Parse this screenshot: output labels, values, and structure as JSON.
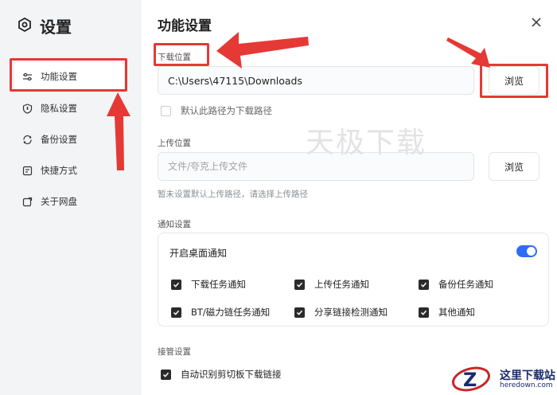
{
  "app": {
    "title": "设置"
  },
  "sidebar": {
    "items": [
      {
        "label": "功能设置",
        "icon": "sliders-icon",
        "active": true
      },
      {
        "label": "隐私设置",
        "icon": "shield-icon",
        "active": false
      },
      {
        "label": "备份设置",
        "icon": "sync-icon",
        "active": false
      },
      {
        "label": "快捷方式",
        "icon": "shortcut-icon",
        "active": false
      },
      {
        "label": "关于网盘",
        "icon": "info-icon",
        "active": false
      }
    ]
  },
  "main": {
    "title": "功能设置",
    "close_icon": "close-icon",
    "download": {
      "label": "下载位置",
      "path": "C:\\Users\\47115\\Downloads",
      "browse_label": "浏览",
      "default_checkbox_label": "默认此路径为下载路径",
      "default_checked": false
    },
    "upload": {
      "label": "上传位置",
      "placeholder": "文件/夸克上传文件",
      "browse_label": "浏览",
      "hint": "暂未设置默认上传路径，请选择上传路径"
    },
    "notify": {
      "label": "通知设置",
      "desktop_label": "开启桌面通知",
      "desktop_enabled": true,
      "options": [
        {
          "label": "下载任务通知",
          "checked": true
        },
        {
          "label": "上传任务通知",
          "checked": true
        },
        {
          "label": "备份任务通知",
          "checked": true
        },
        {
          "label": "BT/磁力链任务通知",
          "checked": true
        },
        {
          "label": "分享链接检测通知",
          "checked": true
        },
        {
          "label": "其他通知",
          "checked": true
        }
      ]
    },
    "takeover": {
      "label": "接管设置",
      "clipboard_label": "自动识别剪切板下载链接",
      "clipboard_checked": true
    }
  },
  "watermark": "天极下载",
  "logo": {
    "cn": "这里下载站",
    "en": "heredown.com"
  },
  "colors": {
    "accent": "#2f6cf6",
    "annotation": "#e53935",
    "sidebar_bg": "#f3f4f6"
  }
}
